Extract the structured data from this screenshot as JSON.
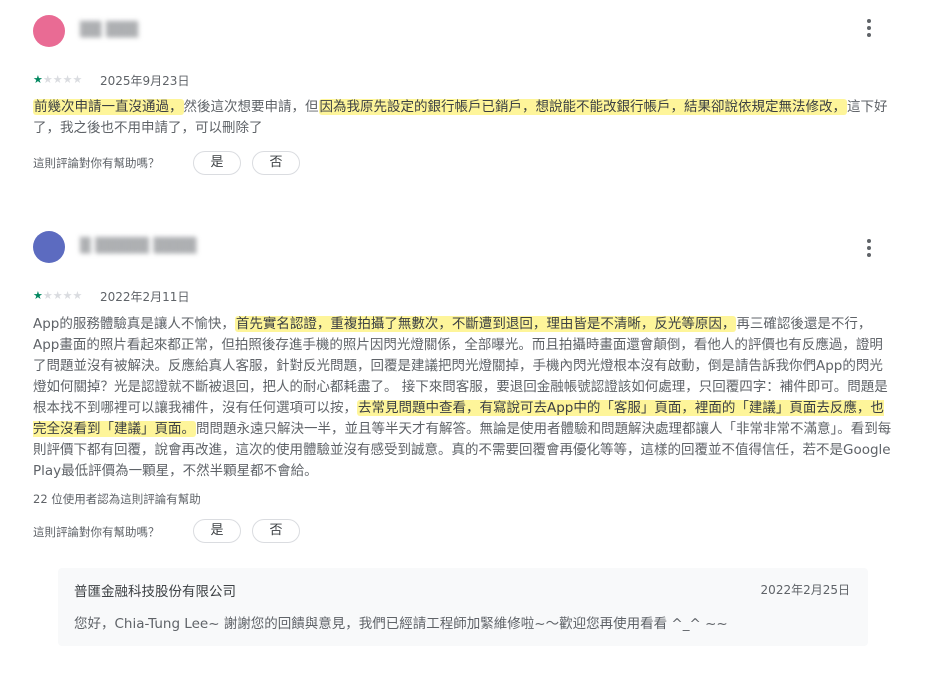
{
  "reviews": [
    {
      "reviewer_name": "▒▒ ▒▒▒",
      "avatar_color": "#e96b94",
      "rating": 1,
      "max_rating": 5,
      "date": "2025年9月23日",
      "text_hl_1": "前幾次申請一直沒通過，",
      "text_plain_1": "然後這次想要申請，但",
      "text_hl_2": "因為我原先設定的銀行帳戶已銷戶，想說能不能改銀行帳戶，結果卻說依規定無法修改，",
      "text_plain_2": "這下好了，我之後也不用申請了，可以刪除了",
      "helpful_question": "這則評論對你有幫助嗎？",
      "yes_label": "是",
      "no_label": "否"
    },
    {
      "reviewer_name": "▒ ▒▒▒▒▒ ▒▒▒▒",
      "avatar_color": "#5c6bc0",
      "rating": 1,
      "max_rating": 5,
      "date": "2022年2月11日",
      "text_plain_1": "App的服務體驗真是讓人不愉快，",
      "text_hl_1": "首先實名認證，重複拍攝了無數次，不斷遭到退回，理由皆是不清晰，反光等原因，",
      "text_plain_2": "再三確認後還是不行，App畫面的照片看起來都正常，但拍照後存進手機的照片因閃光燈關係，全部曝光。而且拍攝時畫面還會顛倒，看他人的評價也有反應過，證明了問題並沒有被解決。反應給真人客服，針對反光問題，回覆是建議把閃光燈關掉，手機內閃光燈根本沒有啟動，倒是請告訴我你們App的閃光燈如何關掉？光是認證就不斷被退回，把人的耐心都耗盡了。 接下來問客服，要退回金融帳號認證該如何處理，只回覆四字：補件即可。問題是根本找不到哪裡可以讓我補件，沒有任何選項可以按，",
      "text_hl_2": "去常見問題中查看，有寫說可去App中的「客服」頁面，裡面的「建議」頁面去反應，也完全沒看到「建議」頁面。",
      "text_plain_3": "問問題永遠只解決一半，並且等半天才有解答。無論是使用者體驗和問題解決處理都讓人「非常非常不滿意」。看到每則評價下都有回覆，說會再改進，這次的使用體驗並沒有感受到誠意。真的不需要回覆會再優化等等，這樣的回覆並不值得信任，若不是Google Play最低評價為一顆星，不然半顆星都不會給。",
      "helpful_count_text": "22 位使用者認為這則評論有幫助",
      "helpful_question": "這則評論對你有幫助嗎？",
      "yes_label": "是",
      "no_label": "否",
      "reply": {
        "developer": "普匯金融科技股份有限公司",
        "date": "2022年2月25日",
        "text": "您好，Chia-Tung Lee~ 謝謝您的回饋與意見，我們已經請工程師加緊維修啦~〜歡迎您再使用看看 ^_^ ~~"
      }
    }
  ],
  "colors": {
    "star_filled": "#01875f",
    "star_empty": "#dadce0",
    "highlight": "#fef59a"
  },
  "icons": [
    "more-vert-icon",
    "star-icon"
  ]
}
